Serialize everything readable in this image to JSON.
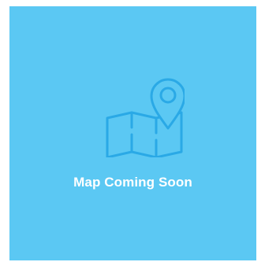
{
  "placeholder": {
    "message": "Map Coming Soon",
    "icon": "map-location-pin-icon",
    "background_color": "#5bc8f3",
    "icon_color": "#2aa9e6",
    "text_color": "#ffffff"
  }
}
